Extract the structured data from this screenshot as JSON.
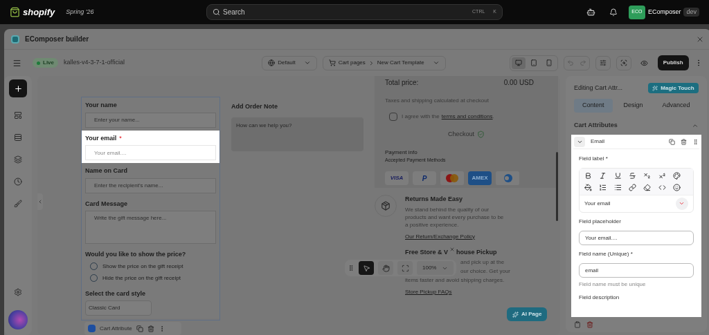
{
  "topbar": {
    "brand": "shopify",
    "edition": "Spring '26",
    "search": {
      "placeholder": "Search",
      "keys": [
        "CTRL",
        "K"
      ]
    },
    "avatar": "ECO",
    "store": "EComposer",
    "badge": "dev"
  },
  "window": {
    "title": "EComposer builder"
  },
  "toolbar": {
    "status": {
      "label": "Live",
      "on": true
    },
    "project": "kalles-v4-3-7-1-official",
    "language": "Default",
    "breadcrumb": [
      "Cart pages",
      "New Cart Template"
    ],
    "devices": [
      {
        "kind": "desktop",
        "selected": true
      },
      {
        "kind": "tablet",
        "selected": false
      },
      {
        "kind": "mobile",
        "selected": false
      }
    ],
    "publish": "Publish"
  },
  "form": {
    "fields": [
      {
        "kind": "input",
        "label": "Your name",
        "placeholder": "Enter your name...",
        "highlighted": false
      },
      {
        "kind": "input",
        "label": "Your email",
        "required_mark": "*",
        "placeholder": "Your email....",
        "highlighted": true
      },
      {
        "kind": "input",
        "label": "Name on Card",
        "placeholder": "Enter the recipient's name...",
        "highlighted": false
      },
      {
        "kind": "textarea",
        "label": "Card Message",
        "placeholder": "Write the gift message here...",
        "highlighted": false
      },
      {
        "kind": "radio",
        "label": "Would you like to show the price?",
        "highlighted": false,
        "options": [
          {
            "label": "Show the price on the gift receipt",
            "selected": false
          },
          {
            "label": "Hide the price on the gift receipt",
            "selected": false
          }
        ]
      },
      {
        "kind": "select",
        "label": "Select the card style",
        "value": "Classic Card",
        "highlighted": false
      }
    ],
    "element_bar": "Cart Attribute"
  },
  "order_note": {
    "title": "Add Order Note",
    "placeholder": "How can we help you?"
  },
  "summary": {
    "total_label": "Total price:",
    "total": "0.00 USD",
    "taxes": "Taxes and shipping calculated at checkout",
    "agree": "I agree with the",
    "agree_link": "terms and conditions",
    "agree_end": ".",
    "agreed": false,
    "checkout": "Checkout",
    "payment_title": "Payment info",
    "payment_subtitle": "Accepted Payment Methods",
    "cards": [
      {
        "kind": "visa",
        "label": "VISA"
      },
      {
        "kind": "paypal",
        "label": "P"
      },
      {
        "kind": "mastercard"
      },
      {
        "kind": "amex",
        "label": "AMEX"
      },
      {
        "kind": "diners"
      }
    ]
  },
  "features": [
    {
      "kind": "returns",
      "title": [
        "Returns Made Easy"
      ],
      "lines": [
        "We stand behind the quality of our products and want every purchase to be a positive experience."
      ],
      "link": "Our Return/Exchange Policy"
    },
    {
      "kind": "pickup",
      "title": [
        "Free Store & V",
        "house Pickup"
      ],
      "lines": [
        "and pick up at the",
        "our choice. Get your",
        "items faster and avoid shipping charges."
      ],
      "link": "Store Pickup FAQs"
    }
  ],
  "zoom": {
    "value": "100%"
  },
  "ai_button": "AI Page",
  "panel": {
    "title": "Editing Cart Attr...",
    "magic": "Magic Touch",
    "tabs": [
      {
        "label": "Content",
        "selected": true
      },
      {
        "label": "Design",
        "selected": false
      },
      {
        "label": "Advanced",
        "selected": false
      }
    ],
    "section": {
      "title": "Cart Attributes",
      "expanded": true
    },
    "item": {
      "title": "Email",
      "expanded": true,
      "highlighted": true,
      "field_label": "Field label *",
      "field_label_value": "Your email",
      "placeholder_field": {
        "label": "Field placeholder",
        "placeholder": "Your email...."
      },
      "name_field": {
        "label": "Field name (Unique) *",
        "value": "email",
        "help": "Field name must be unique"
      },
      "description_label": "Field description"
    }
  }
}
